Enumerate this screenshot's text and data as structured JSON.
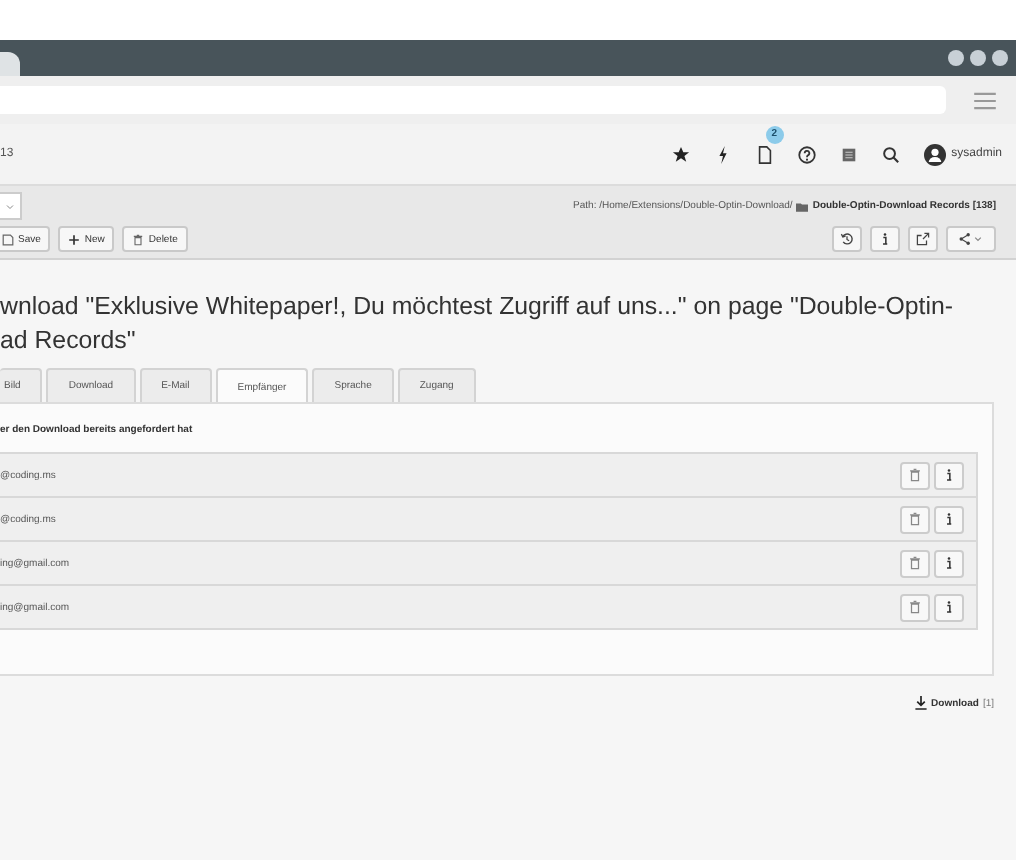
{
  "topbar": {
    "site_label": "13",
    "notification_badge": "2",
    "user": "sysadmin"
  },
  "docheader": {
    "buttons": [
      {
        "label": "Save",
        "kind": "save"
      },
      {
        "label": "New",
        "kind": "new"
      },
      {
        "label": "Delete",
        "kind": "delete"
      }
    ],
    "path_prefix": "Path: /Home/Extensions/Double-Optin-Download/",
    "path_record": "Double-Optin-Download Records [138]"
  },
  "title_lines": [
    "wnload \"Exklusive Whitepaper!, Du möchtest Zugriff auf uns...\" on page \"Double-Optin-",
    "ad Records\""
  ],
  "tabs": [
    {
      "label": "Bild",
      "selected": false
    },
    {
      "label": "Download",
      "selected": false
    },
    {
      "label": "E-Mail",
      "selected": false
    },
    {
      "label": "Empfänger",
      "selected": true
    },
    {
      "label": "Sprache",
      "selected": false
    },
    {
      "label": "Zugang",
      "selected": false
    }
  ],
  "section_heading": "er den Download bereits angefordert hat",
  "recipients": [
    "@coding.ms",
    "@coding.ms",
    "ing@gmail.com",
    "ing@gmail.com"
  ],
  "download_link": {
    "label": "Download",
    "count": "[1]"
  }
}
